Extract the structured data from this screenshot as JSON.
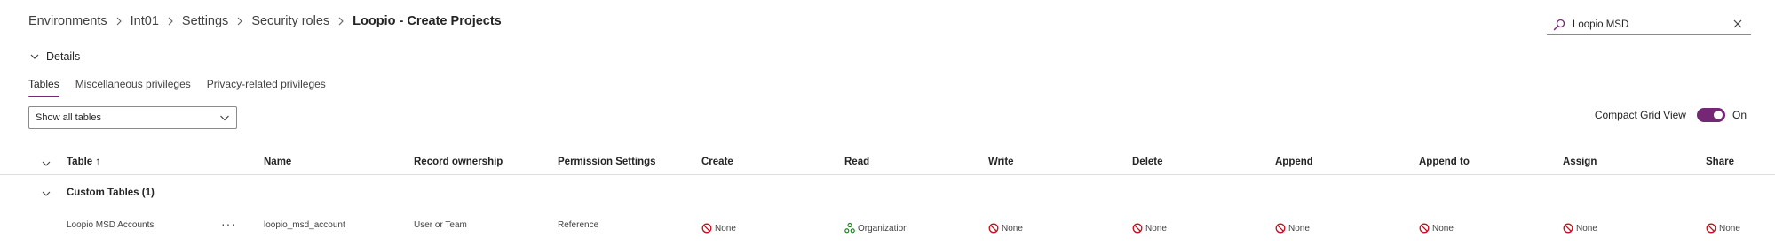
{
  "breadcrumb": {
    "items": [
      "Environments",
      "Int01",
      "Settings",
      "Security roles"
    ],
    "current": "Loopio - Create Projects"
  },
  "search": {
    "value": "Loopio MSD",
    "icon": "search-icon",
    "clear_icon": "close-icon"
  },
  "details": {
    "label": "Details",
    "icon": "chevron-down-icon"
  },
  "tabs": [
    {
      "label": "Tables",
      "active": true
    },
    {
      "label": "Miscellaneous privileges",
      "active": false
    },
    {
      "label": "Privacy-related privileges",
      "active": false
    }
  ],
  "filter": {
    "selected": "Show all tables"
  },
  "compact_view": {
    "label": "Compact Grid View",
    "state": "On",
    "enabled": true,
    "accent": "#742774"
  },
  "grid": {
    "columns": [
      "Table ↑",
      "Name",
      "Record ownership",
      "Permission Settings",
      "Create",
      "Read",
      "Write",
      "Delete",
      "Append",
      "Append to",
      "Assign",
      "Share"
    ],
    "group": {
      "title": "Custom Tables (1)"
    },
    "rows": [
      {
        "table": "Loopio MSD Accounts",
        "more": "···",
        "name": "loopio_msd_account",
        "ownership": "User or Team",
        "permission_settings": "Reference",
        "create": "None",
        "read": "Organization",
        "write": "None",
        "delete": "None",
        "append": "None",
        "append_to": "None",
        "assign": "None",
        "share": "None"
      }
    ]
  },
  "colors": {
    "none_icon": "#c50f1f",
    "organization_icon": "#107c10",
    "accent": "#742774"
  }
}
